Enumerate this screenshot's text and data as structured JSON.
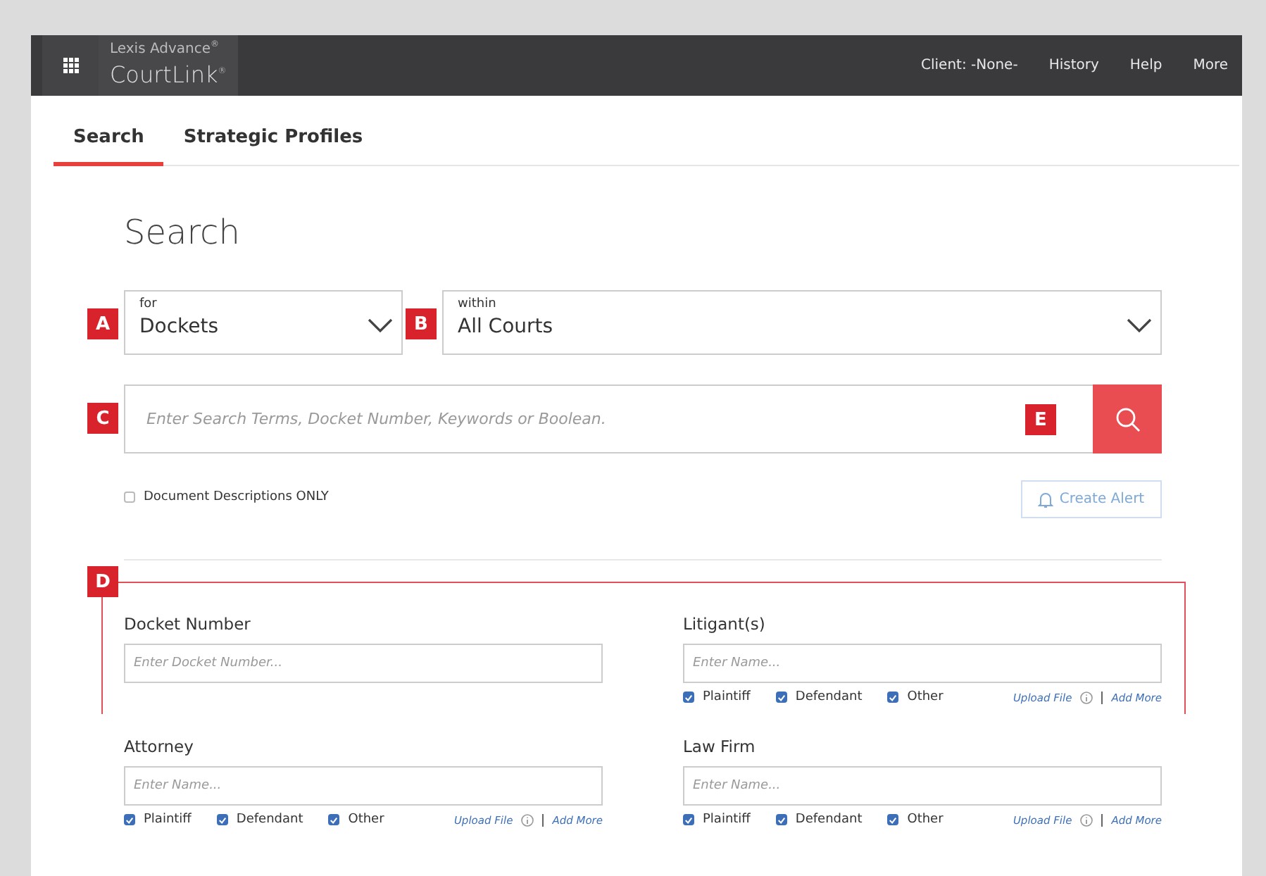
{
  "header": {
    "brand_top": "Lexis Advance",
    "brand_main": "CourtLink",
    "brand_mark": "®",
    "nav": [
      "Client: -None-",
      "History",
      "Help",
      "More"
    ]
  },
  "tabs": [
    {
      "label": "Search",
      "selected": true
    },
    {
      "label": "Strategic Profiles",
      "selected": false
    }
  ],
  "heading": "Search",
  "selects": [
    {
      "label": "for",
      "value": "Dockets",
      "marker": "A"
    },
    {
      "label": "within",
      "value": "All Courts",
      "marker": "B"
    }
  ],
  "search": {
    "placeholder": "Enter Search Terms, Docket Number, Keywords or Boolean.",
    "marker": "C",
    "button_marker": "E"
  },
  "doc_desc": {
    "label": "Document Descriptions ONLY",
    "checked": false
  },
  "create_alert": "Create Alert",
  "section_marker": "D",
  "fields": [
    {
      "label": "Docket Number",
      "placeholder": "Enter Docket Number..."
    },
    {
      "label": "Litigant(s)",
      "placeholder": "Enter Name...",
      "options": [
        {
          "label": "Plaintiff",
          "checked": true
        },
        {
          "label": "Defendant",
          "checked": true
        },
        {
          "label": "Other",
          "checked": true
        }
      ],
      "upload": "Upload File",
      "add_more": "Add More"
    },
    {
      "label": "Attorney",
      "placeholder": "Enter Name...",
      "options": [
        {
          "label": "Plaintiff",
          "checked": true
        },
        {
          "label": "Defendant",
          "checked": true
        },
        {
          "label": "Other",
          "checked": true
        }
      ],
      "upload": "Upload File",
      "add_more": "Add More"
    },
    {
      "label": "Law Firm",
      "placeholder": "Enter Name...",
      "options": [
        {
          "label": "Plaintiff",
          "checked": true
        },
        {
          "label": "Defendant",
          "checked": true
        },
        {
          "label": "Other",
          "checked": true
        }
      ],
      "upload": "Upload File",
      "add_more": "Add More"
    }
  ]
}
